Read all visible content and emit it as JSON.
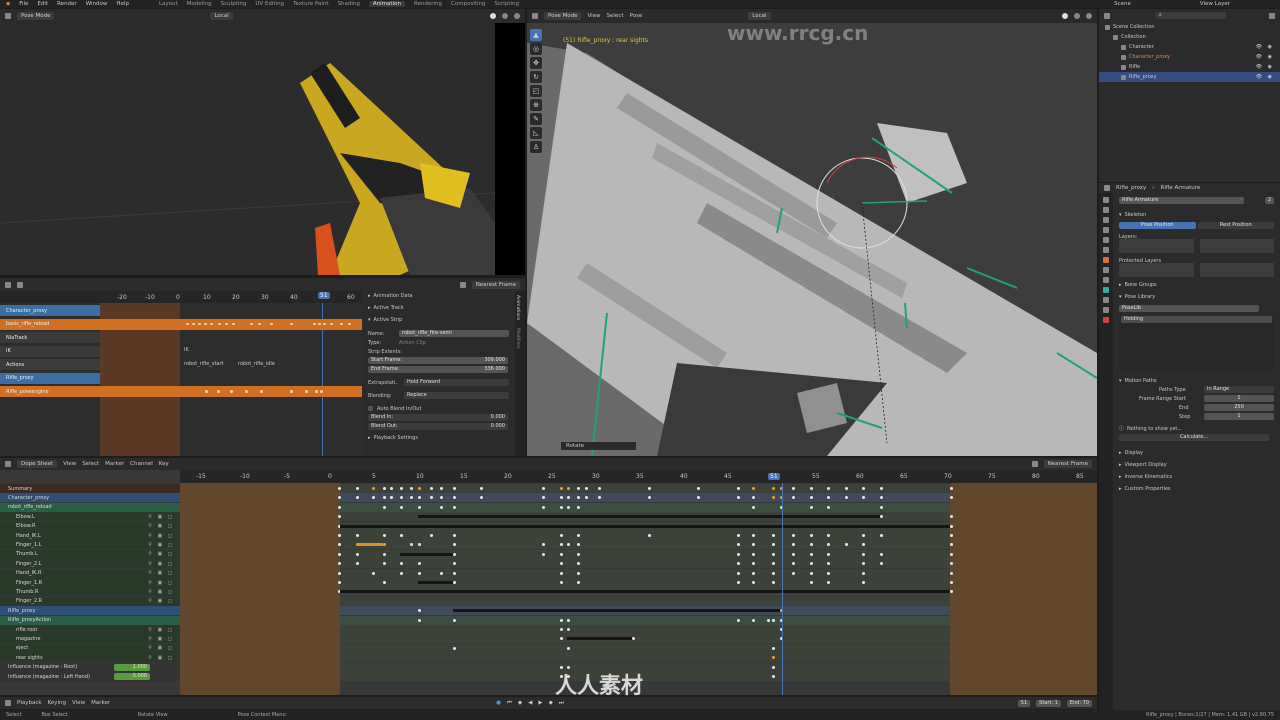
{
  "menu": {
    "items": [
      "File",
      "Edit",
      "Render",
      "Window",
      "Help"
    ],
    "workspaces": [
      "Layout",
      "Modeling",
      "Sculpting",
      "UV Editing",
      "Texture Paint",
      "Shading",
      "Animation",
      "Rendering",
      "Compositing",
      "Scripting"
    ],
    "active_workspace": "Animation",
    "scene": "Scene",
    "view_layer": "View Layer"
  },
  "camera_view": {
    "mode": "Pose Mode",
    "orientation": "Local"
  },
  "main_view": {
    "mode": "Pose Mode",
    "menus": [
      "View",
      "Select",
      "Pose"
    ],
    "orientation": "Local",
    "overlay_text": "(51) Rifle_proxy : rear sights",
    "watermark": "www.rrcg.cn",
    "operator_label": "Rotate"
  },
  "nla": {
    "snap": "Nearest Frame",
    "ruler": [
      "-20",
      "-10",
      "0",
      "10",
      "20",
      "30",
      "40",
      "51",
      "60"
    ],
    "current_frame": "51",
    "tracks": [
      {
        "label": "Character_proxy",
        "kind": "object"
      },
      {
        "label": "basic_rifle_reload",
        "kind": "action"
      },
      {
        "label": "NlaTrack",
        "kind": "track"
      },
      {
        "label": "IK",
        "kind": "track"
      },
      {
        "label": "Actions",
        "kind": "track"
      },
      {
        "label": "Rifle_proxy",
        "kind": "object"
      },
      {
        "label": "Rifle_poseengine",
        "kind": "action"
      }
    ],
    "strip_labels": {
      "ik": "IK",
      "start": "robot_rifle_start",
      "idle": "robot_rifle_idle"
    },
    "sidebar": {
      "animation_data": "Animation Data",
      "active_track": "Active Track",
      "active_strip": "Active Strip",
      "name_label": "Name:",
      "name_value": "robot_rifle_fire-semi",
      "type_label": "Type:",
      "type_value": "Action Clip",
      "extents": "Strip Extents:",
      "start_label": "Start Frame:",
      "start_value": "309.000",
      "end_label": "End Frame:",
      "end_value": "336.000",
      "extrap_label": "Extrapolati..",
      "extrap_value": "Hold Forward",
      "blending_label": "Blending:",
      "blending_value": "Replace",
      "auto_blend": "Auto Blend In/Out",
      "blend_in_label": "Blend In:",
      "blend_in_value": "0.000",
      "blend_out_label": "Blend Out:",
      "blend_out_value": "0.000",
      "playback": "Playback Settings",
      "tabs": [
        "Animations",
        "Modifiers"
      ]
    }
  },
  "dopesheet": {
    "mode": "Dope Sheet",
    "menus": [
      "View",
      "Select",
      "Marker",
      "Channel",
      "Key"
    ],
    "snap": "Nearest Frame",
    "ruler": [
      "-15",
      "-10",
      "-5",
      "0",
      "5",
      "10",
      "15",
      "20",
      "25",
      "30",
      "35",
      "40",
      "45",
      "51",
      "55",
      "60",
      "65",
      "70",
      "75",
      "80",
      "85"
    ],
    "current_frame": "51",
    "channels": [
      {
        "label": "Summary",
        "kind": "summary"
      },
      {
        "label": "Character_proxy",
        "kind": "object"
      },
      {
        "label": "robot_rifle_reload",
        "kind": "action"
      },
      {
        "label": "Elbow.L",
        "kind": "bone"
      },
      {
        "label": "Elbow.R",
        "kind": "bone"
      },
      {
        "label": "Hand_IK.L",
        "kind": "bone"
      },
      {
        "label": "Finger_1.L",
        "kind": "bone"
      },
      {
        "label": "Thumb.L",
        "kind": "bone"
      },
      {
        "label": "Finger_2.L",
        "kind": "bone"
      },
      {
        "label": "Hand_IK.R",
        "kind": "bone"
      },
      {
        "label": "Finger_1.R",
        "kind": "bone"
      },
      {
        "label": "Thumb.R",
        "kind": "bone"
      },
      {
        "label": "Finger_2.R",
        "kind": "bone"
      },
      {
        "label": "Rifle_proxy",
        "kind": "object"
      },
      {
        "label": "Rifle_proxyAction",
        "kind": "action"
      },
      {
        "label": "rifle root",
        "kind": "bone"
      },
      {
        "label": "magazine",
        "kind": "bone"
      },
      {
        "label": "eject",
        "kind": "bone"
      },
      {
        "label": "rear sights",
        "kind": "bone"
      },
      {
        "label": "Influence (magazine : Root)",
        "kind": "influence",
        "value": "1.000"
      },
      {
        "label": "Influence (magazine : Left Hand)",
        "kind": "influence",
        "value": "0.000"
      }
    ]
  },
  "timeline": {
    "menus": [
      "Playback",
      "Keying",
      "View",
      "Marker"
    ],
    "current_frame": "51",
    "start_label": "Start:",
    "start_value": "1",
    "end_label": "End:",
    "end_value": "70"
  },
  "statusbar": {
    "left": [
      "Select",
      "Box Select",
      "Rotate View",
      "Pose Context Menu"
    ],
    "right": "Rifle_proxy | Bones:1/27 | Mem: 1.41 GB | v2.80.75",
    "watermark": "人人素材"
  },
  "outliner": {
    "items": [
      {
        "label": "Scene Collection",
        "depth": 0
      },
      {
        "label": "Collection",
        "depth": 1
      },
      {
        "label": "Character",
        "depth": 2
      },
      {
        "label": "Character_proxy",
        "depth": 2,
        "color": "#e8824a"
      },
      {
        "label": "Rifle",
        "depth": 2
      },
      {
        "label": "Rifle_proxy",
        "depth": 2,
        "selected": true
      }
    ]
  },
  "properties": {
    "object": "Rifle_proxy",
    "data": "Rifle Armature",
    "data_field": "Rifle Armature",
    "user_count": "2",
    "skeleton": "Skeleton",
    "pose_position": "Pose Position",
    "rest_position": "Rest Position",
    "layers": "Layers:",
    "protected_layers": "Protected Layers",
    "bone_groups": "Bone Groups",
    "pose_library": "Pose Library",
    "poselib_name": "PoseLib",
    "pose_item": "Holding",
    "motion_paths": "Motion Paths",
    "paths_type_label": "Paths Type",
    "paths_type_value": "In Range",
    "range_start_label": "Frame Range Start",
    "range_start_value": "1",
    "end_label": "End",
    "end_value": "250",
    "step_label": "Step",
    "step_value": "1",
    "nothing_label": "Nothing to show yet...",
    "calculate": "Calculate...",
    "display": "Display",
    "viewport_display": "Viewport Display",
    "inverse_kinematics": "Inverse Kinematics",
    "custom_properties": "Custom Properties"
  }
}
